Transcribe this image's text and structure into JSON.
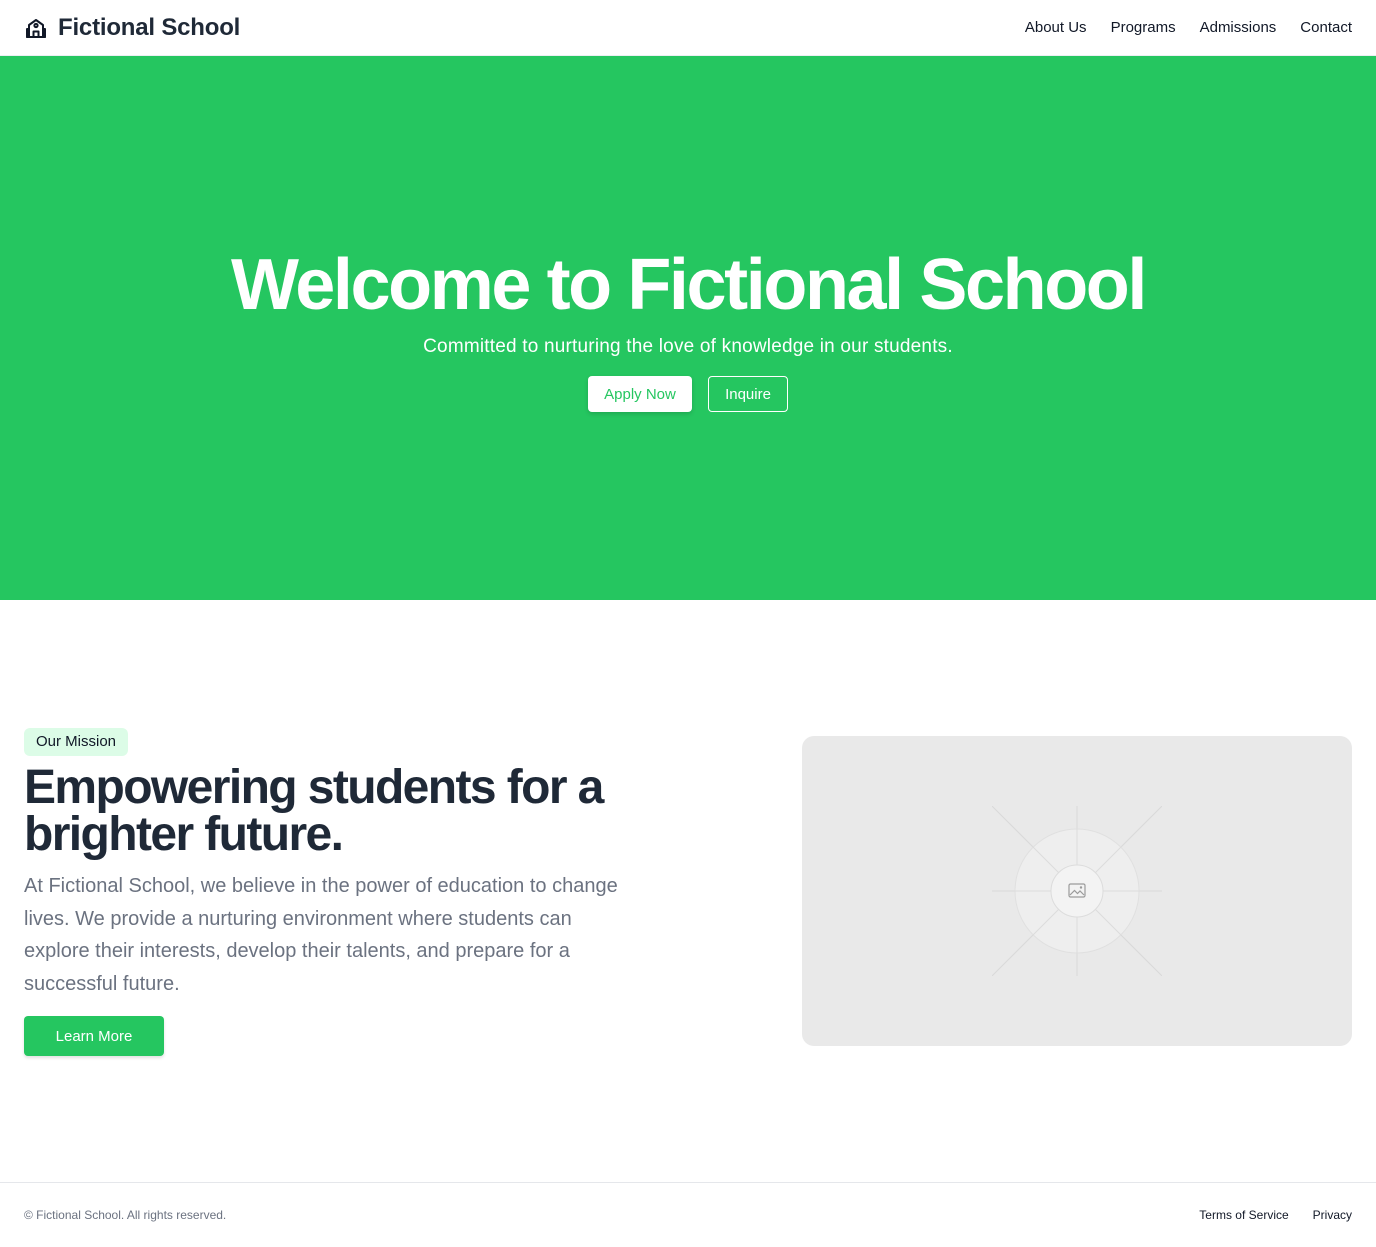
{
  "header": {
    "brand": "Fictional School",
    "brand_icon": "school-building-icon",
    "nav": [
      "About Us",
      "Programs",
      "Admissions",
      "Contact"
    ]
  },
  "hero": {
    "title": "Welcome to Fictional School",
    "subtitle": "Committed to nurturing the love of knowledge in our students.",
    "primary_button": "Apply Now",
    "secondary_button": "Inquire",
    "background": "#25c660"
  },
  "mission": {
    "badge": "Our Mission",
    "title": "Empowering students for a brighter future.",
    "text": "At Fictional School, we believe in the power of education to change lives. We provide a nurturing environment where students can explore their interests, develop their talents, and prepare for a successful future.",
    "button": "Learn More",
    "image_icon": "image-placeholder-icon"
  },
  "footer": {
    "copyright": "© Fictional School. All rights reserved.",
    "links": [
      "Terms of Service",
      "Privacy"
    ]
  },
  "colors": {
    "accent": "#25c660",
    "badge_bg": "#dcfce7",
    "text_dark": "#1f2937",
    "text_muted": "#6b7280"
  }
}
